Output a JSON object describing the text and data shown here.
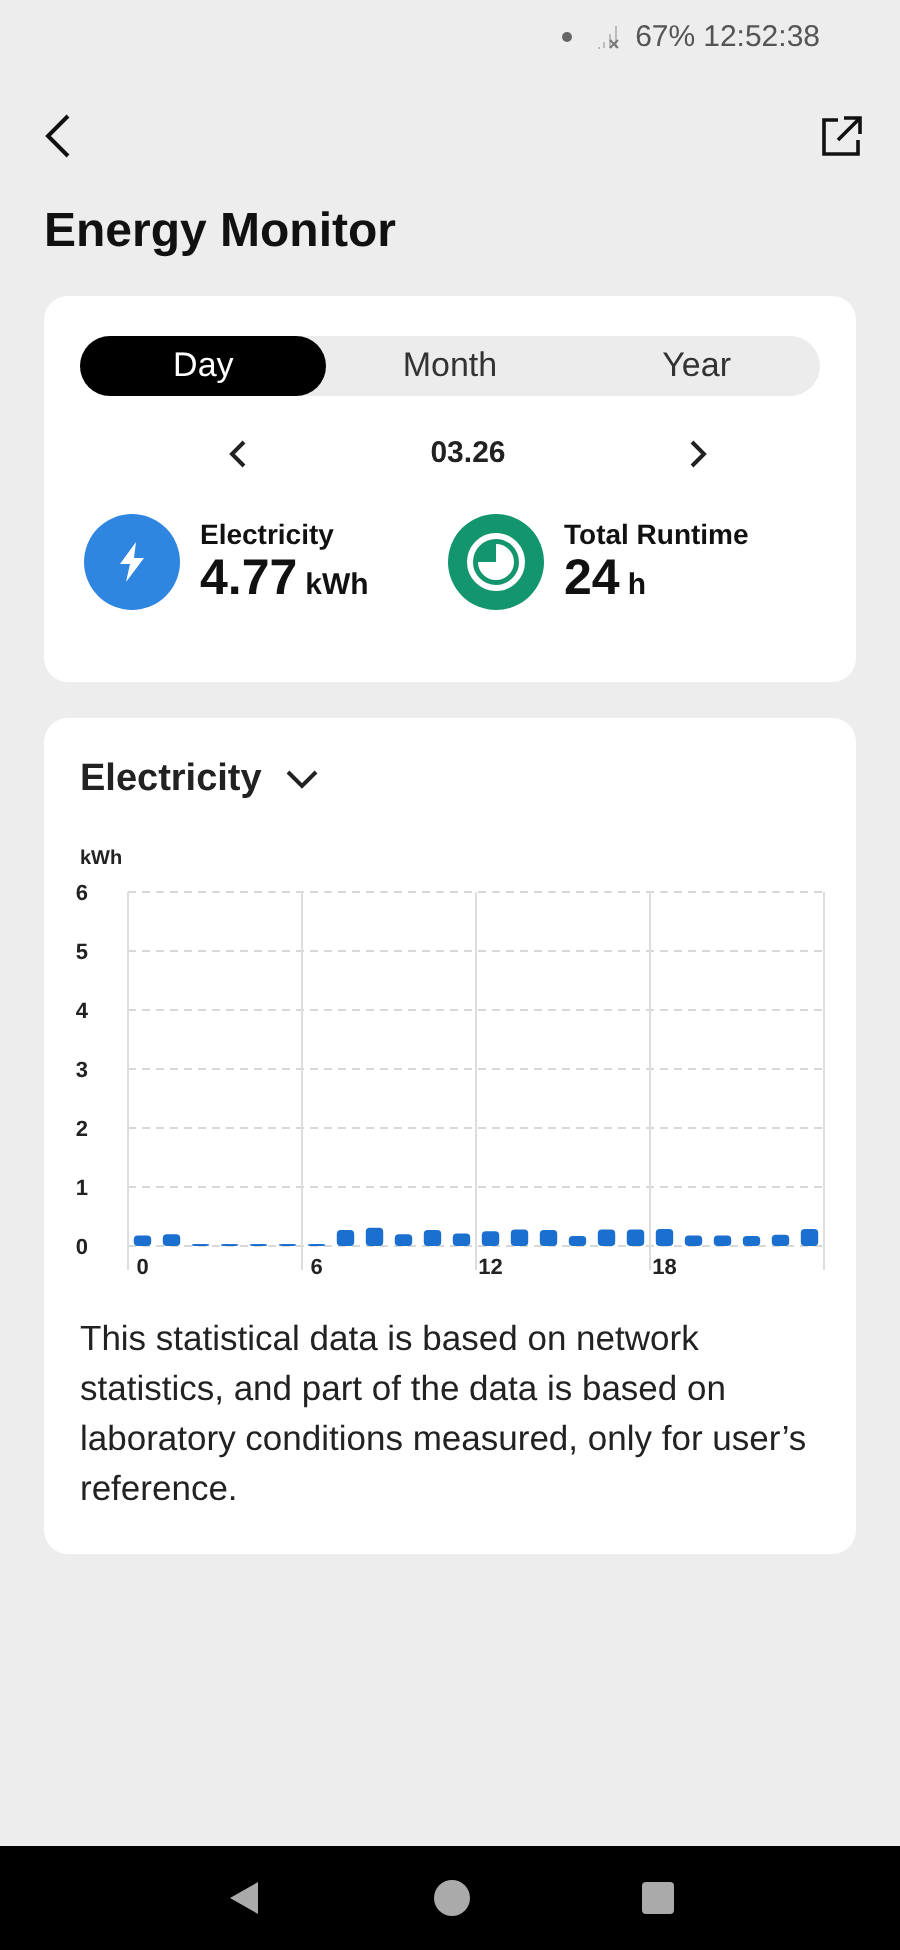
{
  "status_bar": {
    "battery": "67%",
    "time": "12:52:38"
  },
  "title": "Energy Monitor",
  "tabs": [
    {
      "label": "Day",
      "selected": true
    },
    {
      "label": "Month",
      "selected": false
    },
    {
      "label": "Year",
      "selected": false
    }
  ],
  "date": "03.26",
  "stats": [
    {
      "kind": "electricity",
      "label": "Electricity",
      "value": "4.77",
      "unit": "kWh"
    },
    {
      "kind": "runtime",
      "label": "Total Runtime",
      "value": "24",
      "unit": "h"
    }
  ],
  "chart_card": {
    "chart_data": {
      "type": "bar",
      "ylabel": "kWh",
      "x": [
        0,
        1,
        2,
        3,
        4,
        5,
        6,
        7,
        8,
        9,
        10,
        11,
        12,
        13,
        14,
        15,
        16,
        17,
        18,
        19,
        20,
        21,
        22,
        23
      ],
      "grid": true,
      "xlim": [
        -0.5,
        23.5
      ],
      "series": [
        {
          "name": "Electricity",
          "color": "#1a6fcf",
          "values": [
            0.18,
            0.2,
            0.02,
            0.02,
            0.02,
            0.02,
            0.02,
            0.27,
            0.31,
            0.2,
            0.27,
            0.21,
            0.25,
            0.28,
            0.27,
            0.17,
            0.28,
            0.28,
            0.29,
            0.18,
            0.18,
            0.17,
            0.19,
            0.29
          ]
        }
      ],
      "ylim": [
        0,
        6
      ],
      "yticks": [
        0,
        1,
        2,
        3,
        4,
        5,
        6
      ],
      "xticks": [
        {
          "value": 0,
          "label": "0"
        },
        {
          "value": 6,
          "label": "6"
        },
        {
          "value": 12,
          "label": "12"
        },
        {
          "value": 18,
          "label": "18"
        }
      ]
    },
    "note": "This statistical data is based on network statistics, and part of the data is based on laboratory conditions measured, only for user’s reference."
  }
}
